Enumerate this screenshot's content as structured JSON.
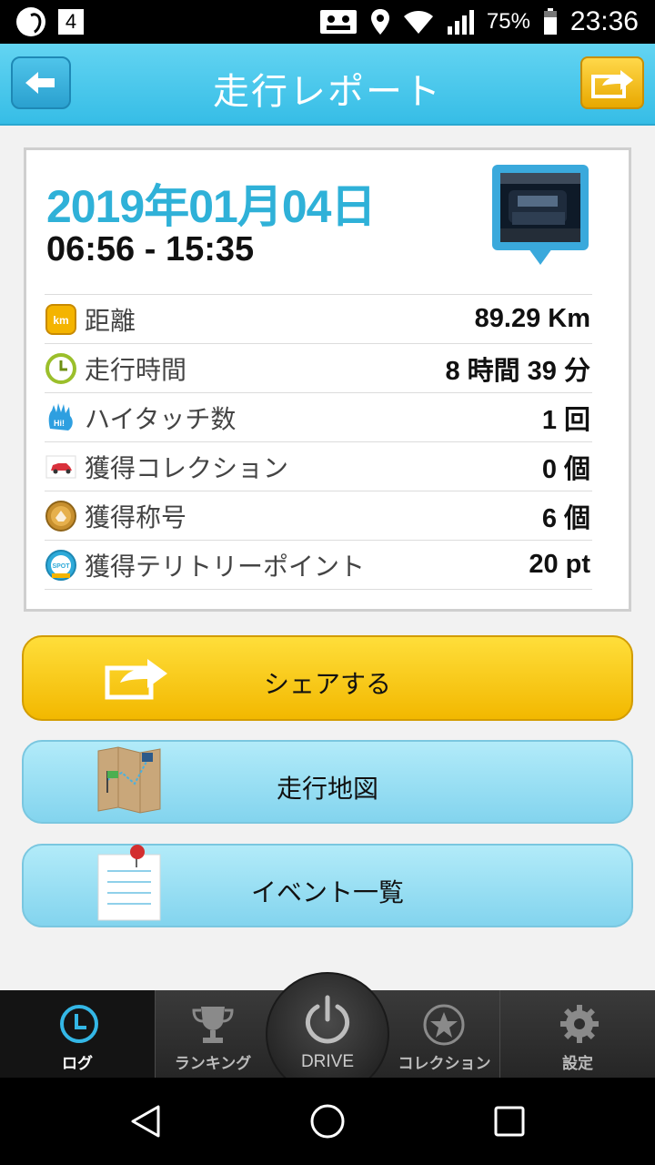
{
  "status_bar": {
    "notification_count": "4",
    "battery": "75%",
    "time": "23:36"
  },
  "header": {
    "title": "走行レポート"
  },
  "report": {
    "date": "2019年01月04日",
    "time_range": "06:56 - 15:35",
    "stats": [
      {
        "icon": "km-icon",
        "label": "距離",
        "value": "89.29 Km"
      },
      {
        "icon": "clock-icon",
        "label": "走行時間",
        "value": "8 時間 39 分"
      },
      {
        "icon": "high-five-icon",
        "label": "ハイタッチ数",
        "value": "1 回"
      },
      {
        "icon": "car-icon",
        "label": "獲得コレクション",
        "value": "0 個"
      },
      {
        "icon": "medal-icon",
        "label": "獲得称号",
        "value": "6 個"
      },
      {
        "icon": "spot-icon",
        "label": "獲得テリトリーポイント",
        "value": "20 pt"
      }
    ]
  },
  "actions": {
    "share": "シェアする",
    "map": "走行地図",
    "events": "イベント一覧"
  },
  "tabs": {
    "log": "ログ",
    "ranking": "ランキング",
    "drive": "DRIVE",
    "collection": "コレクション",
    "settings": "設定"
  },
  "colors": {
    "header": "#36bde6",
    "date": "#2fb1d8",
    "share_button": "#f2b800",
    "light_button": "#83d4ee",
    "active_tab_icon": "#34b7e6"
  }
}
